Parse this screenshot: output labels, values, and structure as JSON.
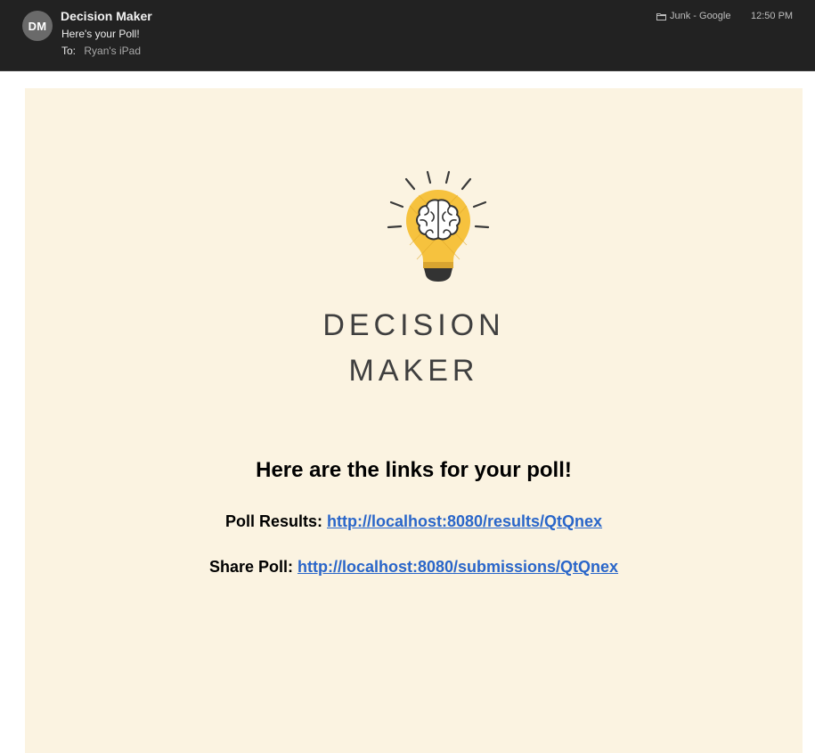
{
  "header": {
    "avatar_initials": "DM",
    "sender": "Decision Maker",
    "subject": "Here's your Poll!",
    "to_label": "To:",
    "to_value": "Ryan's iPad",
    "folder": "Junk - Google",
    "time": "12:50 PM"
  },
  "email": {
    "logo_line1": "DECISION",
    "logo_line2": "MAKER",
    "headline": "Here are the links for your poll!",
    "results_label": "Poll Results:",
    "results_link": "http://localhost:8080/results/QtQnex",
    "share_label": "Share Poll:",
    "share_link": "http://localhost:8080/submissions/QtQnex"
  },
  "colors": {
    "header_bg": "#222222",
    "card_bg": "#fbf3e1",
    "link": "#2a66c9",
    "bulb_yellow": "#f6c23e"
  }
}
